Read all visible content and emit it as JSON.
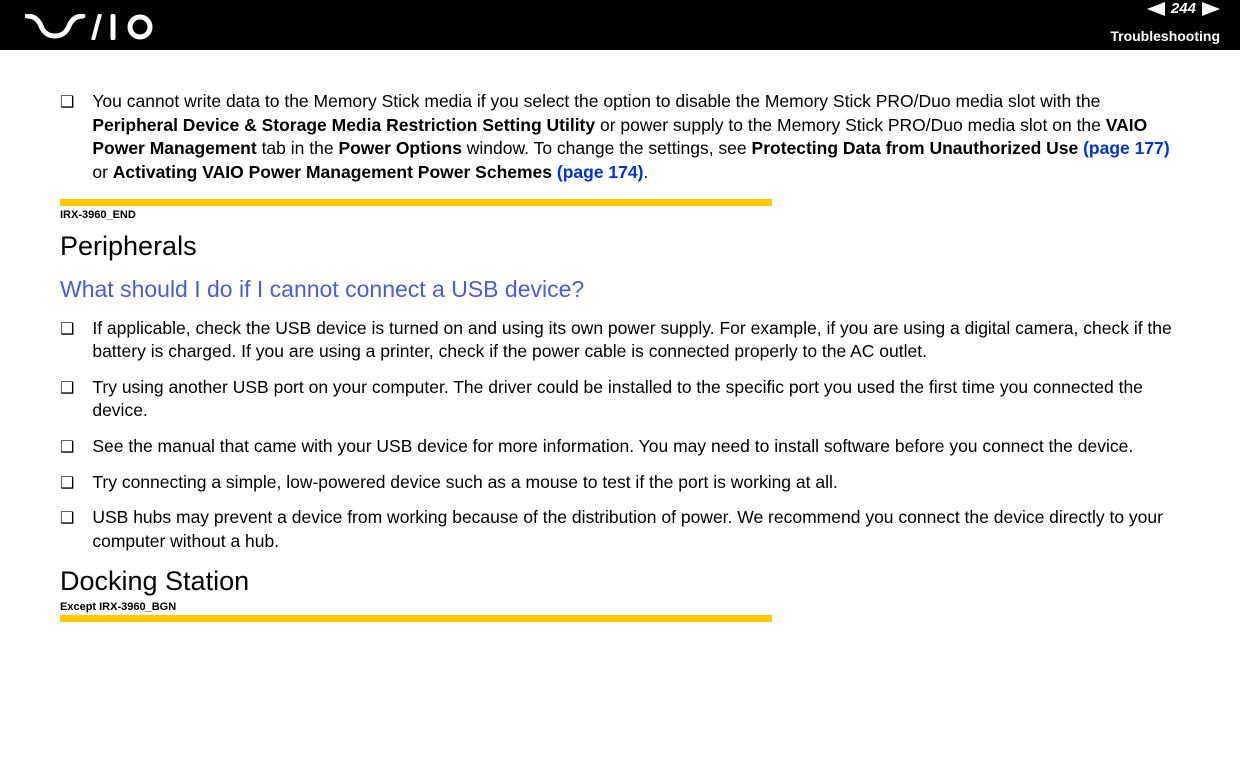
{
  "header": {
    "page_num": "244",
    "section": "Troubleshooting"
  },
  "top_bullet": {
    "part1": "You cannot write data to the Memory Stick media if you select the option to disable the Memory Stick PRO/Duo media slot with the ",
    "bold1": "Peripheral Device & Storage Media Restriction Setting Utility",
    "part2": " or power supply to the Memory Stick PRO/Duo media slot on the ",
    "bold2": "VAIO Power Management",
    "part3": " tab in the ",
    "bold3": "Power Options",
    "part4": " window. To change the settings, see ",
    "bold4": "Protecting Data from Unauthorized Use ",
    "link1": "(page 177)",
    "part5": " or ",
    "bold5": "Activating VAIO Power Management Power Schemes ",
    "link2": "(page 174)",
    "part6": "."
  },
  "annot1": "IRX-3960_END",
  "section1_title": "Peripherals",
  "question1": "What should I do if I cannot connect a USB device?",
  "usb_bullets": [
    "If applicable, check the USB device is turned on and using its own power supply. For example, if you are using a digital camera, check if the battery is charged. If you are using a printer, check if the power cable is connected properly to the AC outlet.",
    "Try using another USB port on your computer. The driver could be installed to the specific port you used the first time you connected the device.",
    "See the manual that came with your USB device for more information. You may need to install software before you connect the device.",
    "Try connecting a simple, low-powered device such as a mouse to test if the port is working at all.",
    "USB hubs may prevent a device from working because of the distribution of power. We recommend you connect the device directly to your computer without a hub."
  ],
  "section2_title": "Docking Station",
  "annot2": "Except IRX-3960_BGN"
}
